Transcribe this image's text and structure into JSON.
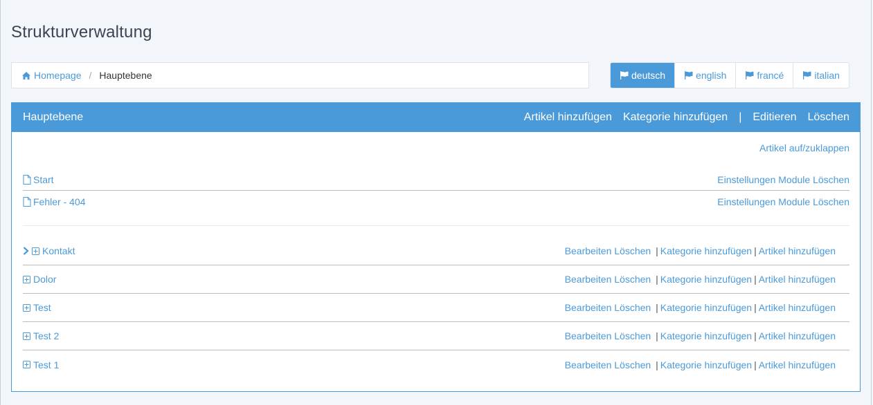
{
  "page": {
    "title": "Strukturverwaltung"
  },
  "breadcrumb": {
    "home": "Homepage",
    "separator": "/",
    "current": "Hauptebene"
  },
  "languages": [
    {
      "label": "deutsch",
      "active": true
    },
    {
      "label": "english",
      "active": false
    },
    {
      "label": "francé",
      "active": false
    },
    {
      "label": "italian",
      "active": false
    }
  ],
  "panel": {
    "title": "Hauptebene",
    "add_article": "Artikel hinzufügen",
    "add_category": "Kategorie hinzufügen",
    "pipe": "|",
    "edit": "Editieren",
    "delete": "Löschen",
    "toggle_articles": "Artikel auf/zuklappen"
  },
  "articles": [
    {
      "name": "Start",
      "settings": "Einstellungen",
      "modules": "Module",
      "delete": "Löschen"
    },
    {
      "name": "Fehler - 404",
      "settings": "Einstellungen",
      "modules": "Module",
      "delete": "Löschen"
    }
  ],
  "categories": [
    {
      "name": "Kontakt",
      "edit": "Bearbeiten",
      "delete": "Löschen",
      "add_category": "Kategorie hinzufügen",
      "add_article": "Artikel hinzufügen",
      "sep": "|"
    },
    {
      "name": "Dolor",
      "edit": "Bearbeiten",
      "delete": "Löschen",
      "add_category": "Kategorie hinzufügen",
      "add_article": "Artikel hinzufügen",
      "sep": "|"
    },
    {
      "name": "Test",
      "edit": "Bearbeiten",
      "delete": "Löschen",
      "add_category": "Kategorie hinzufügen",
      "add_article": "Artikel hinzufügen",
      "sep": "|"
    },
    {
      "name": "Test 2",
      "edit": "Bearbeiten",
      "delete": "Löschen",
      "add_category": "Kategorie hinzufügen",
      "add_article": "Artikel hinzufügen",
      "sep": "|"
    },
    {
      "name": "Test 1",
      "edit": "Bearbeiten",
      "delete": "Löschen",
      "add_category": "Kategorie hinzufügen",
      "add_article": "Artikel hinzufügen",
      "sep": "|"
    }
  ],
  "colors": {
    "accent": "#4a9ad9",
    "background": "#f2f5fa"
  },
  "icons": {
    "home": "home-icon",
    "flag": "flag-icon",
    "file": "file-icon",
    "plus_square": "plus-square-icon",
    "chevron": "chevron-right-icon"
  }
}
